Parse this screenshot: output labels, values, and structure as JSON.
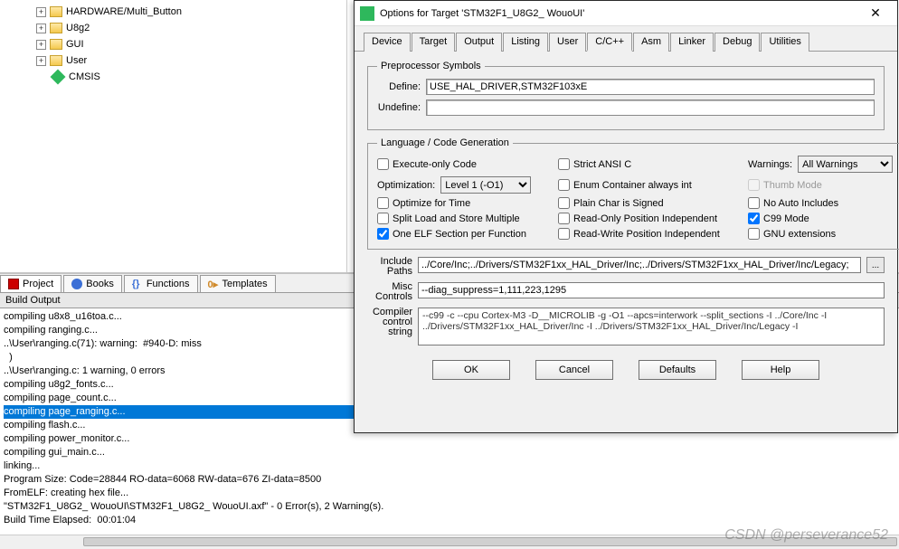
{
  "tree": {
    "nodes": [
      {
        "label": "HARDWARE/Multi_Button",
        "type": "folder",
        "expandable": true
      },
      {
        "label": "U8g2",
        "type": "folder",
        "expandable": true
      },
      {
        "label": "GUI",
        "type": "folder",
        "expandable": true
      },
      {
        "label": "User",
        "type": "folder",
        "expandable": true
      },
      {
        "label": "CMSIS",
        "type": "component",
        "expandable": false
      }
    ]
  },
  "project_tabs": [
    {
      "label": "Project",
      "icon": "proj"
    },
    {
      "label": "Books",
      "icon": "books"
    },
    {
      "label": "Functions",
      "icon": "func"
    },
    {
      "label": "Templates",
      "icon": "tmpl"
    }
  ],
  "build": {
    "header": "Build Output",
    "lines": [
      "compiling u8x8_u16toa.c...",
      "compiling ranging.c...",
      "..\\User\\ranging.c(71): warning:  #940-D: miss",
      "  )",
      "..\\User\\ranging.c: 1 warning, 0 errors",
      "compiling u8g2_fonts.c...",
      "compiling page_count.c...",
      "compiling page_ranging.c...",
      "compiling flash.c...",
      "compiling power_monitor.c...",
      "compiling gui_main.c...",
      "linking...",
      "Program Size: Code=28844 RO-data=6068 RW-data=676 ZI-data=8500",
      "FromELF: creating hex file...",
      "\"STM32F1_U8G2_ WouoUI\\STM32F1_U8G2_ WouoUI.axf\" - 0 Error(s), 2 Warning(s).",
      "Build Time Elapsed:  00:01:04"
    ],
    "selected_line_index": 7
  },
  "dialog": {
    "title": "Options for Target 'STM32F1_U8G2_ WouoUI'",
    "tabs": [
      "Device",
      "Target",
      "Output",
      "Listing",
      "User",
      "C/C++",
      "Asm",
      "Linker",
      "Debug",
      "Utilities"
    ],
    "active_tab": "C/C++",
    "preproc": {
      "legend": "Preprocessor Symbols",
      "define_label": "Define:",
      "define_value": "USE_HAL_DRIVER,STM32F103xE",
      "undefine_label": "Undefine:",
      "undefine_value": ""
    },
    "lang": {
      "legend": "Language / Code Generation",
      "execute_only": {
        "label": "Execute-only Code",
        "checked": false
      },
      "strict_ansi": {
        "label": "Strict ANSI C",
        "checked": false
      },
      "warnings_label": "Warnings:",
      "warnings_value": "All Warnings",
      "optimization_label": "Optimization:",
      "optimization_value": "Level 1 (-O1)",
      "enum_container": {
        "label": "Enum Container always int",
        "checked": false
      },
      "thumb_mode": {
        "label": "Thumb Mode",
        "checked": false,
        "disabled": true
      },
      "optimize_time": {
        "label": "Optimize for Time",
        "checked": false
      },
      "plain_char": {
        "label": "Plain Char is Signed",
        "checked": false
      },
      "no_auto_includes": {
        "label": "No Auto Includes",
        "checked": false
      },
      "split_load": {
        "label": "Split Load and Store Multiple",
        "checked": false
      },
      "readonly_pi": {
        "label": "Read-Only Position Independent",
        "checked": false
      },
      "c99_mode": {
        "label": "C99 Mode",
        "checked": true
      },
      "one_elf": {
        "label": "One ELF Section per Function",
        "checked": true
      },
      "readwrite_pi": {
        "label": "Read-Write Position Independent",
        "checked": false
      },
      "gnu_ext": {
        "label": "GNU extensions",
        "checked": false
      }
    },
    "paths": {
      "include_label": "Include\nPaths",
      "include_value": "../Core/Inc;../Drivers/STM32F1xx_HAL_Driver/Inc;../Drivers/STM32F1xx_HAL_Driver/Inc/Legacy;",
      "misc_label": "Misc\nControls",
      "misc_value": "--diag_suppress=1,111,223,1295",
      "compiler_label": "Compiler\ncontrol\nstring",
      "compiler_value": "--c99 -c --cpu Cortex-M3 -D__MICROLIB -g -O1 --apcs=interwork --split_sections -I ../Core/Inc -I ../Drivers/STM32F1xx_HAL_Driver/Inc -I ../Drivers/STM32F1xx_HAL_Driver/Inc/Legacy -I"
    },
    "buttons": {
      "ok": "OK",
      "cancel": "Cancel",
      "defaults": "Defaults",
      "help": "Help"
    }
  },
  "watermark": "CSDN @perseverance52"
}
